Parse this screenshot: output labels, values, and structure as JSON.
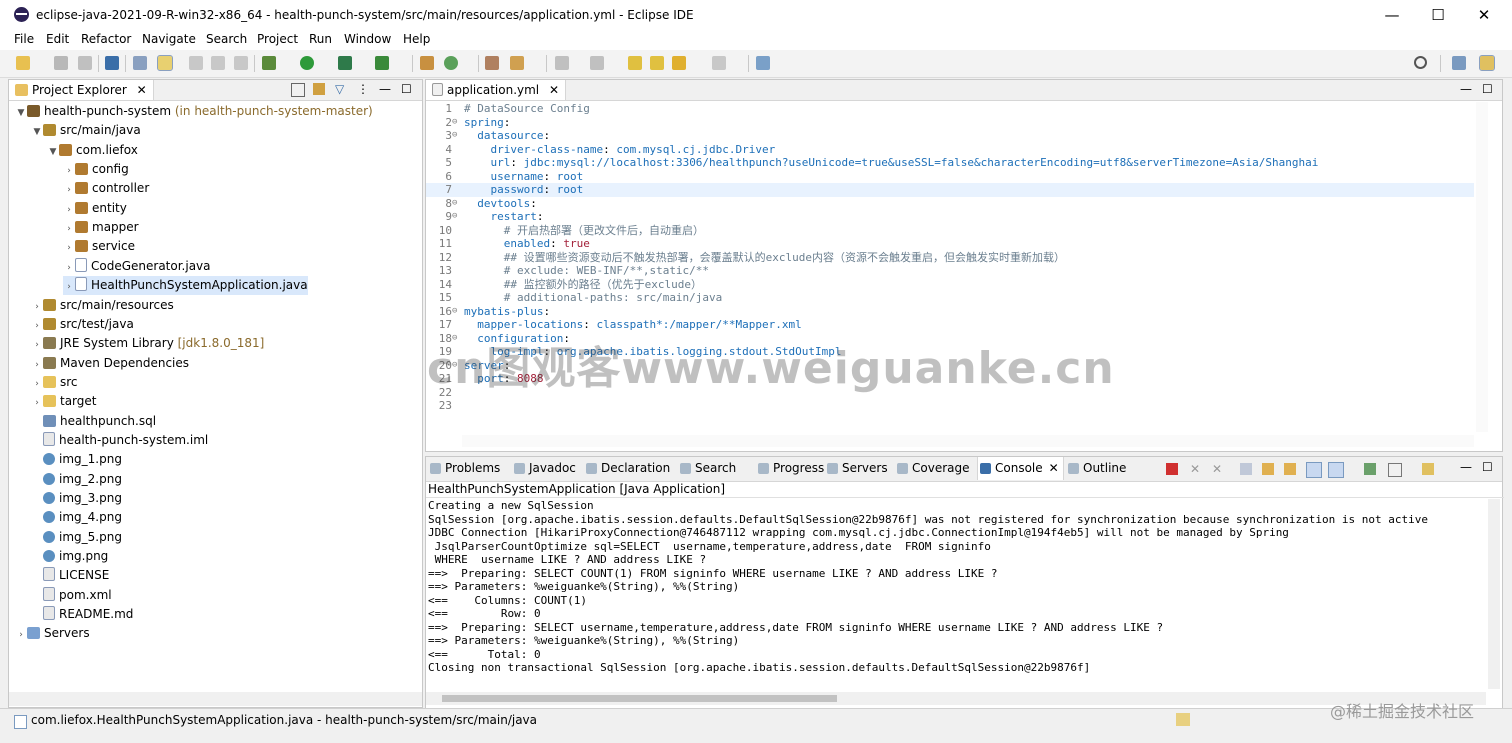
{
  "window": {
    "title": "eclipse-java-2021-09-R-win32-x86_64 - health-punch-system/src/main/resources/application.yml - Eclipse IDE",
    "minimize": "—",
    "maximize": "☐",
    "close": "✕"
  },
  "menu": [
    "File",
    "Edit",
    "Refactor",
    "Navigate",
    "Search",
    "Project",
    "Run",
    "Window",
    "Help"
  ],
  "explorer": {
    "tab": "Project Explorer",
    "tree": [
      {
        "label": "health-punch-system",
        "extra": " (in health-punch-system-master)",
        "indent": 0,
        "twisty": "▼",
        "icon": "project-icon",
        "color": "#7a5a2a"
      },
      {
        "label": "src/main/java",
        "extra": "",
        "indent": 1,
        "twisty": "▼",
        "icon": "source-folder-icon",
        "color": "#b08a30"
      },
      {
        "label": "com.liefox",
        "extra": "",
        "indent": 2,
        "twisty": "▼",
        "icon": "package-icon",
        "color": "#b07a30"
      },
      {
        "label": "config",
        "extra": "",
        "indent": 3,
        "twisty": "›",
        "icon": "package-icon",
        "color": "#b07a30"
      },
      {
        "label": "controller",
        "extra": "",
        "indent": 3,
        "twisty": "›",
        "icon": "package-icon",
        "color": "#b07a30"
      },
      {
        "label": "entity",
        "extra": "",
        "indent": 3,
        "twisty": "›",
        "icon": "package-icon",
        "color": "#b07a30"
      },
      {
        "label": "mapper",
        "extra": "",
        "indent": 3,
        "twisty": "›",
        "icon": "package-icon",
        "color": "#b07a30"
      },
      {
        "label": "service",
        "extra": "",
        "indent": 3,
        "twisty": "›",
        "icon": "package-icon",
        "color": "#b07a30"
      },
      {
        "label": "CodeGenerator.java",
        "extra": "",
        "indent": 3,
        "twisty": "›",
        "icon": "java-file-icon",
        "color": "#ffffff"
      },
      {
        "label": "HealthPunchSystemApplication.java",
        "extra": "",
        "indent": 3,
        "twisty": "›",
        "icon": "java-file-icon",
        "color": "#ffffff",
        "selected": true
      },
      {
        "label": "src/main/resources",
        "extra": "",
        "indent": 1,
        "twisty": "›",
        "icon": "source-folder-icon",
        "color": "#b08a30"
      },
      {
        "label": "src/test/java",
        "extra": "",
        "indent": 1,
        "twisty": "›",
        "icon": "source-folder-icon",
        "color": "#b08a30"
      },
      {
        "label": "JRE System Library",
        "extra": " [jdk1.8.0_181]",
        "indent": 1,
        "twisty": "›",
        "icon": "library-icon",
        "color": "#8a7a50"
      },
      {
        "label": "Maven Dependencies",
        "extra": "",
        "indent": 1,
        "twisty": "›",
        "icon": "library-icon",
        "color": "#8a7a50"
      },
      {
        "label": "src",
        "extra": "",
        "indent": 1,
        "twisty": "›",
        "icon": "folder-icon",
        "color": "#e6c25a"
      },
      {
        "label": "target",
        "extra": "",
        "indent": 1,
        "twisty": "›",
        "icon": "folder-icon",
        "color": "#e6c25a"
      },
      {
        "label": "healthpunch.sql",
        "extra": "",
        "indent": 1,
        "twisty": "",
        "icon": "sql-file-icon",
        "color": "#6f8fb8"
      },
      {
        "label": "health-punch-system.iml",
        "extra": "",
        "indent": 1,
        "twisty": "",
        "icon": "file-icon",
        "color": "#e8e8e8"
      },
      {
        "label": "img_1.png",
        "extra": "",
        "indent": 1,
        "twisty": "",
        "icon": "image-file-icon",
        "color": "#5a8fc0"
      },
      {
        "label": "img_2.png",
        "extra": "",
        "indent": 1,
        "twisty": "",
        "icon": "image-file-icon",
        "color": "#5a8fc0"
      },
      {
        "label": "img_3.png",
        "extra": "",
        "indent": 1,
        "twisty": "",
        "icon": "image-file-icon",
        "color": "#5a8fc0"
      },
      {
        "label": "img_4.png",
        "extra": "",
        "indent": 1,
        "twisty": "",
        "icon": "image-file-icon",
        "color": "#5a8fc0"
      },
      {
        "label": "img_5.png",
        "extra": "",
        "indent": 1,
        "twisty": "",
        "icon": "image-file-icon",
        "color": "#5a8fc0"
      },
      {
        "label": "img.png",
        "extra": "",
        "indent": 1,
        "twisty": "",
        "icon": "image-file-icon",
        "color": "#5a8fc0"
      },
      {
        "label": "LICENSE",
        "extra": "",
        "indent": 1,
        "twisty": "",
        "icon": "file-icon",
        "color": "#e8e8e8"
      },
      {
        "label": "pom.xml",
        "extra": "",
        "indent": 1,
        "twisty": "",
        "icon": "file-icon",
        "color": "#e8e8e8"
      },
      {
        "label": "README.md",
        "extra": "",
        "indent": 1,
        "twisty": "",
        "icon": "file-icon",
        "color": "#e8e8e8"
      },
      {
        "label": "Servers",
        "extra": "",
        "indent": 0,
        "twisty": "›",
        "icon": "folder-icon",
        "color": "#7aa0d0"
      }
    ]
  },
  "editor": {
    "tab": "application.yml",
    "lines": [
      {
        "n": "1",
        "fold": "",
        "segs": [
          [
            "c",
            "# DataSource Config"
          ]
        ]
      },
      {
        "n": "2",
        "fold": "⊖",
        "segs": [
          [
            "k",
            "spring"
          ],
          [
            "",
            ":"
          ]
        ]
      },
      {
        "n": "3",
        "fold": "⊖",
        "segs": [
          [
            "",
            "  "
          ],
          [
            "k",
            "datasource"
          ],
          [
            "",
            ":"
          ]
        ]
      },
      {
        "n": "4",
        "fold": "",
        "segs": [
          [
            "",
            "    "
          ],
          [
            "k",
            "driver-class-name"
          ],
          [
            "",
            ": "
          ],
          [
            "v",
            "com.mysql.cj.jdbc.Driver"
          ]
        ]
      },
      {
        "n": "5",
        "fold": "",
        "segs": [
          [
            "",
            "    "
          ],
          [
            "k",
            "url"
          ],
          [
            "",
            ": "
          ],
          [
            "v",
            "jdbc:mysql://localhost:3306/healthpunch?useUnicode=true&useSSL=false&characterEncoding=utf8&serverTimezone=Asia/Shanghai"
          ]
        ]
      },
      {
        "n": "6",
        "fold": "",
        "segs": [
          [
            "",
            "    "
          ],
          [
            "k",
            "username"
          ],
          [
            "",
            ": "
          ],
          [
            "v",
            "root"
          ]
        ]
      },
      {
        "n": "7",
        "fold": "",
        "segs": [
          [
            "",
            "    "
          ],
          [
            "k",
            "password"
          ],
          [
            "",
            ": "
          ],
          [
            "v",
            "root"
          ]
        ],
        "current": true
      },
      {
        "n": "8",
        "fold": "⊖",
        "segs": [
          [
            "",
            "  "
          ],
          [
            "k",
            "devtools"
          ],
          [
            "",
            ":"
          ]
        ]
      },
      {
        "n": "9",
        "fold": "⊖",
        "segs": [
          [
            "",
            "    "
          ],
          [
            "k",
            "restart"
          ],
          [
            "",
            ":"
          ]
        ]
      },
      {
        "n": "10",
        "fold": "",
        "segs": [
          [
            "",
            "      "
          ],
          [
            "c",
            "# 开启热部署（更改文件后，自动重启）"
          ]
        ]
      },
      {
        "n": "11",
        "fold": "",
        "segs": [
          [
            "",
            "      "
          ],
          [
            "k",
            "enabled"
          ],
          [
            "",
            ": "
          ],
          [
            "n",
            "true"
          ]
        ]
      },
      {
        "n": "12",
        "fold": "",
        "segs": [
          [
            "",
            "      "
          ],
          [
            "c",
            "## 设置哪些资源变动后不触发热部署，会覆盖默认的exclude内容（资源不会触发重启，但会触发实时重新加载）"
          ]
        ]
      },
      {
        "n": "13",
        "fold": "",
        "segs": [
          [
            "",
            "      "
          ],
          [
            "c",
            "# exclude: WEB-INF/**,static/**"
          ]
        ]
      },
      {
        "n": "14",
        "fold": "",
        "segs": [
          [
            "",
            "      "
          ],
          [
            "c",
            "## 监控额外的路径（优先于exclude）"
          ]
        ]
      },
      {
        "n": "15",
        "fold": "",
        "segs": [
          [
            "",
            "      "
          ],
          [
            "c",
            "# additional-paths: src/main/java"
          ]
        ]
      },
      {
        "n": "16",
        "fold": "⊖",
        "segs": [
          [
            "k",
            "mybatis-plus"
          ],
          [
            "",
            ":"
          ]
        ]
      },
      {
        "n": "17",
        "fold": "",
        "segs": [
          [
            "",
            "  "
          ],
          [
            "k",
            "mapper-locations"
          ],
          [
            "",
            ": "
          ],
          [
            "v",
            "classpath*:/mapper/**Mapper.xml"
          ]
        ]
      },
      {
        "n": "18",
        "fold": "⊖",
        "segs": [
          [
            "",
            "  "
          ],
          [
            "k",
            "configuration"
          ],
          [
            "",
            ":"
          ]
        ]
      },
      {
        "n": "19",
        "fold": "",
        "segs": [
          [
            "",
            "    "
          ],
          [
            "k",
            "log-impl"
          ],
          [
            "",
            ": "
          ],
          [
            "v",
            "org.apache.ibatis.logging.stdout.StdOutImpl"
          ]
        ]
      },
      {
        "n": "20",
        "fold": "⊖",
        "segs": [
          [
            "k",
            "server"
          ],
          [
            "",
            ":"
          ]
        ]
      },
      {
        "n": "21",
        "fold": "",
        "segs": [
          [
            "",
            "  "
          ],
          [
            "k",
            "port"
          ],
          [
            "",
            ": "
          ],
          [
            "n",
            "8088"
          ]
        ]
      },
      {
        "n": "22",
        "fold": "",
        "segs": []
      },
      {
        "n": "23",
        "fold": "",
        "segs": []
      }
    ]
  },
  "bottom": {
    "tabs": [
      {
        "label": "Problems",
        "icon": "problems-icon"
      },
      {
        "label": "Javadoc",
        "icon": "javadoc-icon"
      },
      {
        "label": "Declaration",
        "icon": "declaration-icon"
      },
      {
        "label": "Search",
        "icon": "search-icon"
      },
      {
        "label": "Progress",
        "icon": "progress-icon"
      },
      {
        "label": "Servers",
        "icon": "servers-icon"
      },
      {
        "label": "Coverage",
        "icon": "coverage-icon"
      },
      {
        "label": "Console",
        "icon": "console-icon",
        "active": true
      },
      {
        "label": "Outline",
        "icon": "outline-icon"
      }
    ],
    "console_title": "HealthPunchSystemApplication [Java Application]",
    "console_lines": [
      "Creating a new SqlSession",
      "SqlSession [org.apache.ibatis.session.defaults.DefaultSqlSession@22b9876f] was not registered for synchronization because synchronization is not active",
      "JDBC Connection [HikariProxyConnection@746487112 wrapping com.mysql.cj.jdbc.ConnectionImpl@194f4eb5] will not be managed by Spring",
      " JsqlParserCountOptimize sql=SELECT  username,temperature,address,date  FROM signinfo",
      " WHERE  username LIKE ? AND address LIKE ?",
      "==>  Preparing: SELECT COUNT(1) FROM signinfo WHERE username LIKE ? AND address LIKE ?",
      "==> Parameters: %weiguanke%(String), %%(String)",
      "<==    Columns: COUNT(1)",
      "<==        Row: 0",
      "==>  Preparing: SELECT username,temperature,address,date FROM signinfo WHERE username LIKE ? AND address LIKE ?",
      "==> Parameters: %weiguanke%(String), %%(String)",
      "<==      Total: 0",
      "Closing non transactional SqlSession [org.apache.ibatis.session.defaults.DefaultSqlSession@22b9876f]"
    ]
  },
  "status": {
    "text": "com.liefox.HealthPunchSystemApplication.java - health-punch-system/src/main/java",
    "credit": "@稀土掘金技术社区"
  },
  "watermark": "cn图观客www.weiguanke.cn",
  "colors": {
    "accent": "#1d6fb8",
    "selection": "#d9e8fb",
    "comment": "#6b7f8f",
    "number": "#a3213a"
  }
}
